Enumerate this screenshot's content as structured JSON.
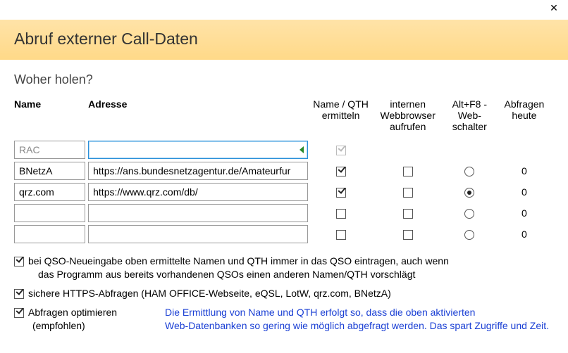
{
  "window": {
    "close_glyph": "✕"
  },
  "header": {
    "title": "Abruf externer Call-Daten"
  },
  "section_title": "Woher holen?",
  "cols": {
    "name": "Name",
    "addr": "Adresse",
    "nameqth": "Name / QTH ermitteln",
    "web": "internen Webbrowser aufrufen",
    "altf8": "Alt+F8 - Web-schalter",
    "today": "Abfragen heute"
  },
  "rows": [
    {
      "name": "RAC",
      "addr": "",
      "nameqth": true,
      "nameqth_disabled": true,
      "web": null,
      "altf8": null,
      "today": "",
      "readonly": true,
      "focused": true
    },
    {
      "name": "BNetzA",
      "addr": "https://ans.bundesnetzagentur.de/Amateurfur",
      "nameqth": true,
      "nameqth_disabled": false,
      "web": false,
      "altf8": false,
      "today": "0",
      "readonly": false
    },
    {
      "name": "qrz.com",
      "addr": "https://www.qrz.com/db/",
      "nameqth": true,
      "nameqth_disabled": false,
      "web": false,
      "altf8": true,
      "today": "0",
      "readonly": false
    },
    {
      "name": "",
      "addr": "",
      "nameqth": false,
      "nameqth_disabled": false,
      "web": false,
      "altf8": false,
      "today": "0",
      "readonly": false
    },
    {
      "name": "",
      "addr": "",
      "nameqth": false,
      "nameqth_disabled": false,
      "web": false,
      "altf8": false,
      "today": "0",
      "readonly": false
    }
  ],
  "opts": {
    "opt1": "bei QSO-Neueingabe oben ermittelte Namen und QTH immer in das QSO eintragen, auch wenn",
    "opt1b": "das Programm aus bereits vorhandenen QSOs einen anderen Namen/QTH vorschlägt",
    "opt1_checked": true,
    "opt2": "sichere HTTPS-Abfragen (HAM OFFICE-Webseite, eQSL, LotW, qrz.com, BNetzA)",
    "opt2_checked": true,
    "opt3": "Abfragen optimieren",
    "opt3_sub": "(empfohlen)",
    "opt3_checked": true,
    "opt3_help1": "Die Ermittlung von Name und QTH erfolgt so, dass die oben aktivierten",
    "opt3_help2": "Web-Datenbanken so gering wie möglich abgefragt werden. Das spart Zugriffe und Zeit."
  }
}
